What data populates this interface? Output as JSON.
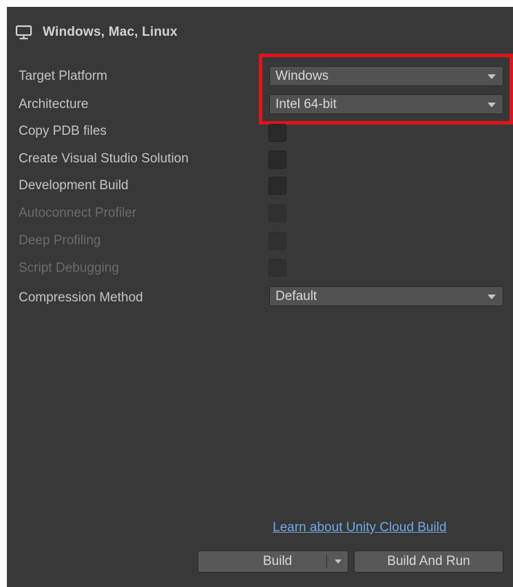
{
  "header": {
    "title": "Windows, Mac, Linux",
    "icon": "monitor-icon"
  },
  "settings": {
    "target_platform": {
      "label": "Target Platform",
      "value": "Windows"
    },
    "architecture": {
      "label": "Architecture",
      "value": "Intel 64-bit"
    },
    "copy_pdb": {
      "label": "Copy PDB files",
      "checked": false
    },
    "create_vs_solution": {
      "label": "Create Visual Studio Solution",
      "checked": false
    },
    "development_build": {
      "label": "Development Build",
      "checked": false
    },
    "autoconnect_profiler": {
      "label": "Autoconnect Profiler",
      "checked": false,
      "enabled": false
    },
    "deep_profiling": {
      "label": "Deep Profiling",
      "checked": false,
      "enabled": false
    },
    "script_debugging": {
      "label": "Script Debugging",
      "checked": false,
      "enabled": false
    },
    "compression_method": {
      "label": "Compression Method",
      "value": "Default"
    }
  },
  "footer": {
    "cloud_build_link": "Learn about Unity Cloud Build",
    "build_label": "Build",
    "build_and_run_label": "Build And Run"
  },
  "colors": {
    "panel_bg": "#383838",
    "highlight": "#e0141c",
    "link": "#72a6ea"
  }
}
